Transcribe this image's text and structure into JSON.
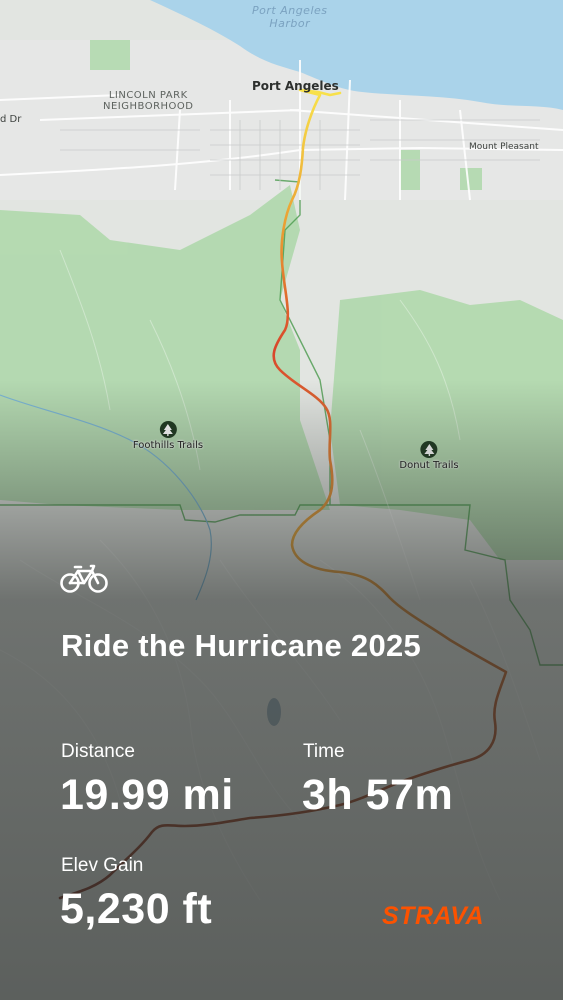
{
  "map": {
    "water_label_line1": "Port Angeles",
    "water_label_line2": "Harbor",
    "neighborhood_line1": "LINCOLN PARK",
    "neighborhood_line2": "NEIGHBORHOOD",
    "road_label": "d Dr",
    "city_label": "Port Angeles",
    "mount_pleasant_label": "Mount Pleasant",
    "poi_foothills": "Foothills Trails",
    "poi_donut": "Donut Trails",
    "trail_icon": "tree-icon",
    "route_colors": [
      "#f7e04a",
      "#f08a2b",
      "#d6402a",
      "#8a3a2a"
    ],
    "water_color": "#aad3ea",
    "park_color": "#8fd18b"
  },
  "activity": {
    "type_icon": "bicycle-icon",
    "title": "Ride the Hurricane 2025",
    "distance_label": "Distance",
    "distance_value": "19.99 mi",
    "time_label": "Time",
    "time_value": "3h 57m",
    "elev_label": "Elev Gain",
    "elev_value": "5,230 ft"
  },
  "brand": {
    "name": "STRAVA",
    "color": "#fc5200"
  }
}
